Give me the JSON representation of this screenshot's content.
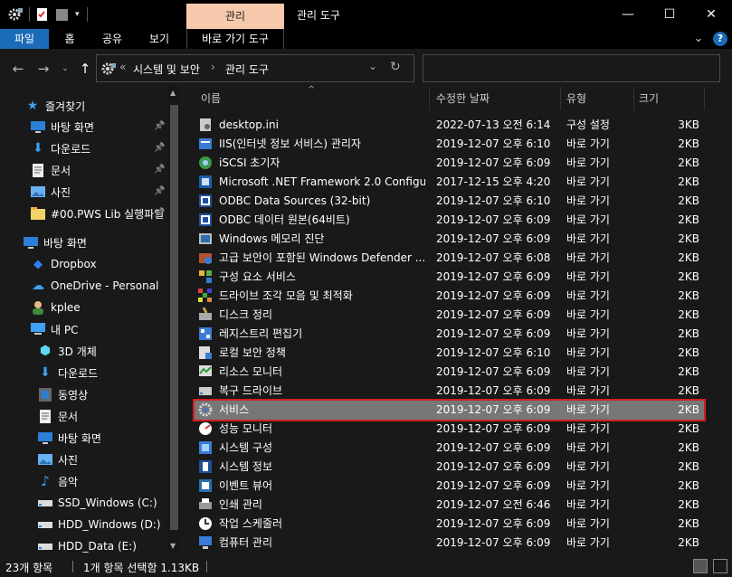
{
  "window": {
    "contextual_tab": "관리",
    "title": "관리 도구",
    "minimize": "—",
    "maximize": "☐",
    "close": "✕"
  },
  "ribbon": {
    "file": "파일",
    "tabs": [
      "홈",
      "공유",
      "보기"
    ],
    "context_sub": "바로 가기 도구",
    "expand": "⌄",
    "help": "?"
  },
  "address": {
    "overflow": "«",
    "crumbs": [
      "시스템 및 보안",
      "관리 도구"
    ],
    "sep": "›",
    "dropdown": "⌄",
    "refresh": "↻",
    "search_placeholder": ""
  },
  "nav": {
    "quick_access": "즐겨찾기",
    "items": [
      {
        "label": "바탕 화면",
        "icon": "desktop-icon",
        "pinned": true
      },
      {
        "label": "다운로드",
        "icon": "download-icon",
        "pinned": true
      },
      {
        "label": "문서",
        "icon": "document-icon",
        "pinned": true
      },
      {
        "label": "사진",
        "icon": "picture-icon",
        "pinned": true
      },
      {
        "label": "#00.PWS Lib 실행파일",
        "icon": "folder-icon",
        "pinned": true
      },
      {
        "label": "바탕 화면",
        "icon": "desktop-icon",
        "pinned": false
      },
      {
        "label": "Dropbox",
        "icon": "dropbox-icon",
        "pinned": false
      },
      {
        "label": "OneDrive - Personal",
        "icon": "onedrive-icon",
        "pinned": false
      },
      {
        "label": "kplee",
        "icon": "user-icon",
        "pinned": false
      },
      {
        "label": "내 PC",
        "icon": "pc-icon",
        "pinned": false
      },
      {
        "label": "3D 개체",
        "icon": "3d-objects-icon",
        "pinned": false
      },
      {
        "label": "다운로드",
        "icon": "download-icon",
        "pinned": false
      },
      {
        "label": "동영상",
        "icon": "video-icon",
        "pinned": false
      },
      {
        "label": "문서",
        "icon": "document-icon",
        "pinned": false
      },
      {
        "label": "바탕 화면",
        "icon": "desktop-icon",
        "pinned": false
      },
      {
        "label": "사진",
        "icon": "picture-icon",
        "pinned": false
      },
      {
        "label": "음악",
        "icon": "music-icon",
        "pinned": false
      },
      {
        "label": "SSD_Windows (C:)",
        "icon": "drive-icon",
        "pinned": false
      },
      {
        "label": "HDD_Windows (D:)",
        "icon": "drive-icon",
        "pinned": false
      },
      {
        "label": "HDD_Data (E:)",
        "icon": "drive-icon",
        "pinned": false
      }
    ]
  },
  "columns": {
    "name": "이름",
    "date": "수정한 날짜",
    "type": "유형",
    "size": "크기"
  },
  "files": [
    {
      "name": "desktop.ini",
      "date": "2022-07-13 오전 6:14",
      "type": "구성 설정",
      "size": "3KB",
      "icon": "settings-file-icon"
    },
    {
      "name": "IIS(인터넷 정보 서비스) 관리자",
      "date": "2019-12-07 오후 6:10",
      "type": "바로 가기",
      "size": "2KB",
      "icon": "iis-icon"
    },
    {
      "name": "iSCSI 초기자",
      "date": "2019-12-07 오후 6:09",
      "type": "바로 가기",
      "size": "2KB",
      "icon": "iscsi-icon"
    },
    {
      "name": "Microsoft .NET Framework 2.0 Configur...",
      "date": "2017-12-15 오후 4:20",
      "type": "바로 가기",
      "size": "2KB",
      "icon": "dotnet-icon"
    },
    {
      "name": "ODBC Data Sources (32-bit)",
      "date": "2019-12-07 오후 6:10",
      "type": "바로 가기",
      "size": "2KB",
      "icon": "odbc-icon"
    },
    {
      "name": "ODBC 데이터 원본(64비트)",
      "date": "2019-12-07 오후 6:09",
      "type": "바로 가기",
      "size": "2KB",
      "icon": "odbc-icon"
    },
    {
      "name": "Windows 메모리 진단",
      "date": "2019-12-07 오후 6:09",
      "type": "바로 가기",
      "size": "2KB",
      "icon": "memory-icon"
    },
    {
      "name": "고급 보안이 포함된 Windows Defender ...",
      "date": "2019-12-07 오후 6:08",
      "type": "바로 가기",
      "size": "2KB",
      "icon": "firewall-icon"
    },
    {
      "name": "구성 요소 서비스",
      "date": "2019-12-07 오후 6:09",
      "type": "바로 가기",
      "size": "2KB",
      "icon": "component-icon"
    },
    {
      "name": "드라이브 조각 모음 및 최적화",
      "date": "2019-12-07 오후 6:09",
      "type": "바로 가기",
      "size": "2KB",
      "icon": "defrag-icon"
    },
    {
      "name": "디스크 정리",
      "date": "2019-12-07 오후 6:09",
      "type": "바로 가기",
      "size": "2KB",
      "icon": "cleanup-icon"
    },
    {
      "name": "레지스트리 편집기",
      "date": "2019-12-07 오후 6:09",
      "type": "바로 가기",
      "size": "2KB",
      "icon": "registry-icon"
    },
    {
      "name": "로컬 보안 정책",
      "date": "2019-12-07 오후 6:10",
      "type": "바로 가기",
      "size": "2KB",
      "icon": "policy-icon"
    },
    {
      "name": "리소스 모니터",
      "date": "2019-12-07 오후 6:09",
      "type": "바로 가기",
      "size": "2KB",
      "icon": "monitor-icon"
    },
    {
      "name": "복구 드라이브",
      "date": "2019-12-07 오후 6:09",
      "type": "바로 가기",
      "size": "2KB",
      "icon": "recovery-icon"
    },
    {
      "name": "서비스",
      "date": "2019-12-07 오후 6:09",
      "type": "바로 가기",
      "size": "2KB",
      "icon": "services-icon",
      "selected": true
    },
    {
      "name": "성능 모니터",
      "date": "2019-12-07 오후 6:09",
      "type": "바로 가기",
      "size": "2KB",
      "icon": "perf-icon"
    },
    {
      "name": "시스템 구성",
      "date": "2019-12-07 오후 6:09",
      "type": "바로 가기",
      "size": "2KB",
      "icon": "sysconfig-icon"
    },
    {
      "name": "시스템 정보",
      "date": "2019-12-07 오후 6:09",
      "type": "바로 가기",
      "size": "2KB",
      "icon": "sysinfo-icon"
    },
    {
      "name": "이벤트 뷰어",
      "date": "2019-12-07 오후 6:09",
      "type": "바로 가기",
      "size": "2KB",
      "icon": "event-icon"
    },
    {
      "name": "인쇄 관리",
      "date": "2019-12-07 오전 6:46",
      "type": "바로 가기",
      "size": "2KB",
      "icon": "print-icon"
    },
    {
      "name": "작업 스케줄러",
      "date": "2019-12-07 오후 6:09",
      "type": "바로 가기",
      "size": "2KB",
      "icon": "scheduler-icon"
    },
    {
      "name": "컴퓨터 관리",
      "date": "2019-12-07 오후 6:09",
      "type": "바로 가기",
      "size": "2KB",
      "icon": "computer-mgmt-icon"
    }
  ],
  "status": {
    "count": "23개 항목",
    "selection": "1개 항목 선택함 1.13KB"
  },
  "colors": {
    "background": "#191919",
    "selection": "#777777",
    "highlight_border": "#d21f1f",
    "accent": "#1a6bb8",
    "context_tab": "#f7c9ac"
  }
}
